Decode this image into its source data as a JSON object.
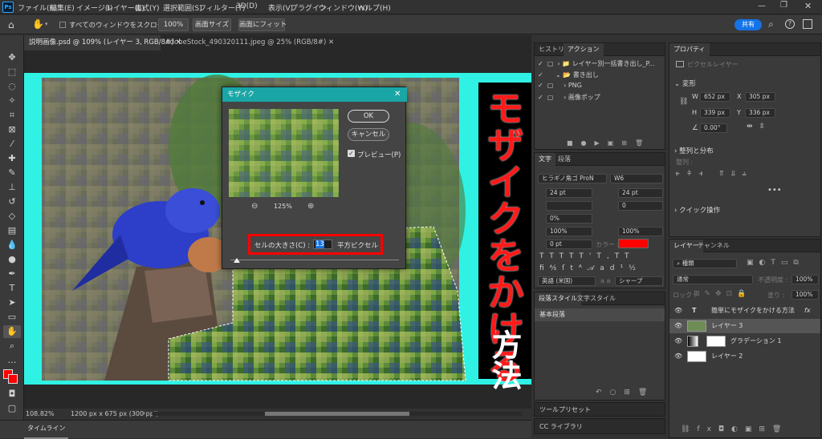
{
  "app": {
    "logo": "Ps"
  },
  "menu": [
    "ファイル(F)",
    "編集(E)",
    "イメージ(I)",
    "レイヤー(L)",
    "書式(Y)",
    "選択範囲(S)",
    "フィルター(T)",
    "3D(D)",
    "表示(V)",
    "プラグイン",
    "ウィンドウ(W)",
    "ヘルプ(H)"
  ],
  "options": {
    "scroll_all": "すべてのウィンドウをスクロール",
    "zoom": "100%",
    "screen_size": "画面サイズ",
    "fit_screen": "画面にフィット",
    "share": "共有"
  },
  "tabs": [
    {
      "label": "説明画像.psd @ 109% (レイヤー 3, RGB/8#)"
    },
    {
      "label": "AdobeStock_490320111.jpeg @ 25% (RGB/8#)"
    }
  ],
  "status": {
    "zoom": "108.82%",
    "doc_info": "1200 px x 675 px (300 ppi)"
  },
  "timeline": {
    "label": "タイムライン"
  },
  "canvas": {
    "title_main": "モザイクをかける",
    "title_sub": "方法",
    "colors": {
      "cyan": "#2ff2e4",
      "red": "#ff1a1a"
    }
  },
  "dialog": {
    "title": "モザイク",
    "ok": "OK",
    "cancel": "キャンセル",
    "preview": "プレビュー(P)",
    "zoom": "125%",
    "cell_label": "セルの大きさ(C) :",
    "cell_value": "13",
    "cell_unit": "平方ピクセル"
  },
  "history_panel": {
    "tabs": [
      "ヒストリー",
      "アクション"
    ],
    "items": [
      "レイヤー別一括書き出し_P...",
      "書き出し",
      "PNG",
      "画像ポップ"
    ]
  },
  "char_panel": {
    "tabs": [
      "文字",
      "段落"
    ],
    "font": "ヒラギノ角ゴ ProN",
    "style": "W6",
    "size": "24 pt",
    "leading": "24 pt",
    "tracking": "0",
    "percent1": "0%",
    "scale1": "100%",
    "scale2": "100%",
    "baseline": "0 pt",
    "color_label": "カラー :",
    "language": "英語 (米国)",
    "aa_label": "a a",
    "aa": "シャープ"
  },
  "para_styles": {
    "tabs": [
      "段落スタイル",
      "文字スタイル"
    ],
    "item": "基本段落"
  },
  "tool_presets": {
    "label": "ツールプリセット"
  },
  "cc_libraries": {
    "label": "CC ライブラリ"
  },
  "properties": {
    "tab": "プロパティ",
    "kind": "ピクセルレイヤー",
    "transform": "変形",
    "w_label": "W",
    "w": "652 px",
    "x_label": "X",
    "x": "305 px",
    "h_label": "H",
    "h": "339 px",
    "y_label": "Y",
    "y": "336 px",
    "angle": "0.00°",
    "align_label": "整列と分布",
    "align_sub": "整列 :",
    "quick": "クイック操作"
  },
  "layers_panel": {
    "tabs": [
      "レイヤー",
      "チャンネル"
    ],
    "filter_kind": "種類",
    "blend": "通常",
    "opacity_label": "不透明度 :",
    "opacity": "100%",
    "lock_label": "ロック :",
    "fill_label": "塗り :",
    "fill": "100%",
    "layers": [
      {
        "name": "簡単にモザイクをかける方法",
        "type": "text",
        "fx": "fx"
      },
      {
        "name": "レイヤー 3",
        "type": "image"
      },
      {
        "name": "グラデーション 1",
        "type": "gradient"
      },
      {
        "name": "レイヤー 2",
        "type": "white"
      }
    ]
  }
}
